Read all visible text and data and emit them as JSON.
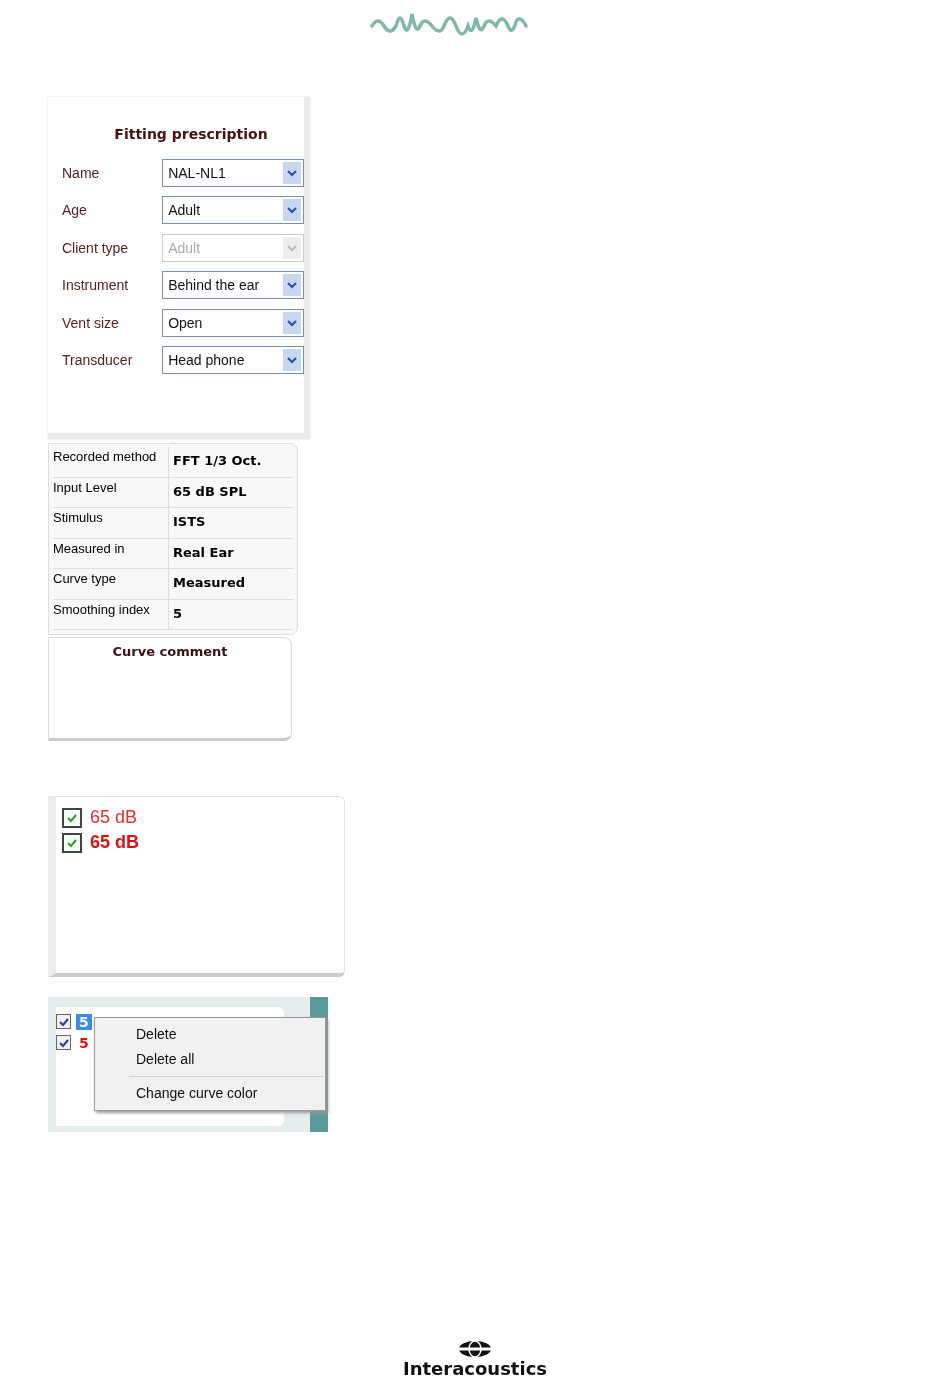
{
  "fitting_prescription": {
    "title": "Fitting prescription",
    "fields": [
      {
        "label": "Name",
        "value": "NAL-NL1",
        "disabled": false
      },
      {
        "label": "Age",
        "value": "Adult",
        "disabled": false
      },
      {
        "label": "Client type",
        "value": "Adult",
        "disabled": true
      },
      {
        "label": "Instrument",
        "value": "Behind the ear",
        "disabled": false
      },
      {
        "label": "Vent size",
        "value": "Open",
        "disabled": false
      },
      {
        "label": "Transducer",
        "value": "Head phone",
        "disabled": false
      }
    ]
  },
  "recording_info": {
    "rows": [
      {
        "label": "Recorded method",
        "value": "FFT 1/3 Oct."
      },
      {
        "label": "Input Level",
        "value": "65 dB SPL"
      },
      {
        "label": "Stimulus",
        "value": "ISTS"
      },
      {
        "label": "Measured in",
        "value": "Real Ear"
      },
      {
        "label": "Curve type",
        "value": "Measured"
      },
      {
        "label": "Smoothing index",
        "value": "5"
      }
    ]
  },
  "curve_comment": {
    "title": "Curve comment"
  },
  "curve_list": {
    "items": [
      {
        "label": "65 dB",
        "checked": true,
        "bold": false,
        "color": "#e03030"
      },
      {
        "label": "65 dB",
        "checked": true,
        "bold": true,
        "color": "#e01010"
      }
    ]
  },
  "context_example": {
    "items": [
      {
        "label": "5",
        "checked": true,
        "selected": true
      },
      {
        "label": "5",
        "checked": true,
        "selected": false,
        "color": "#e01010"
      }
    ],
    "menu": [
      {
        "label": "Delete",
        "separator_before": false
      },
      {
        "label": "Delete all",
        "separator_before": false
      },
      {
        "label": "Change curve color",
        "separator_before": true
      }
    ]
  },
  "footer": {
    "brand": "Interacoustics"
  }
}
